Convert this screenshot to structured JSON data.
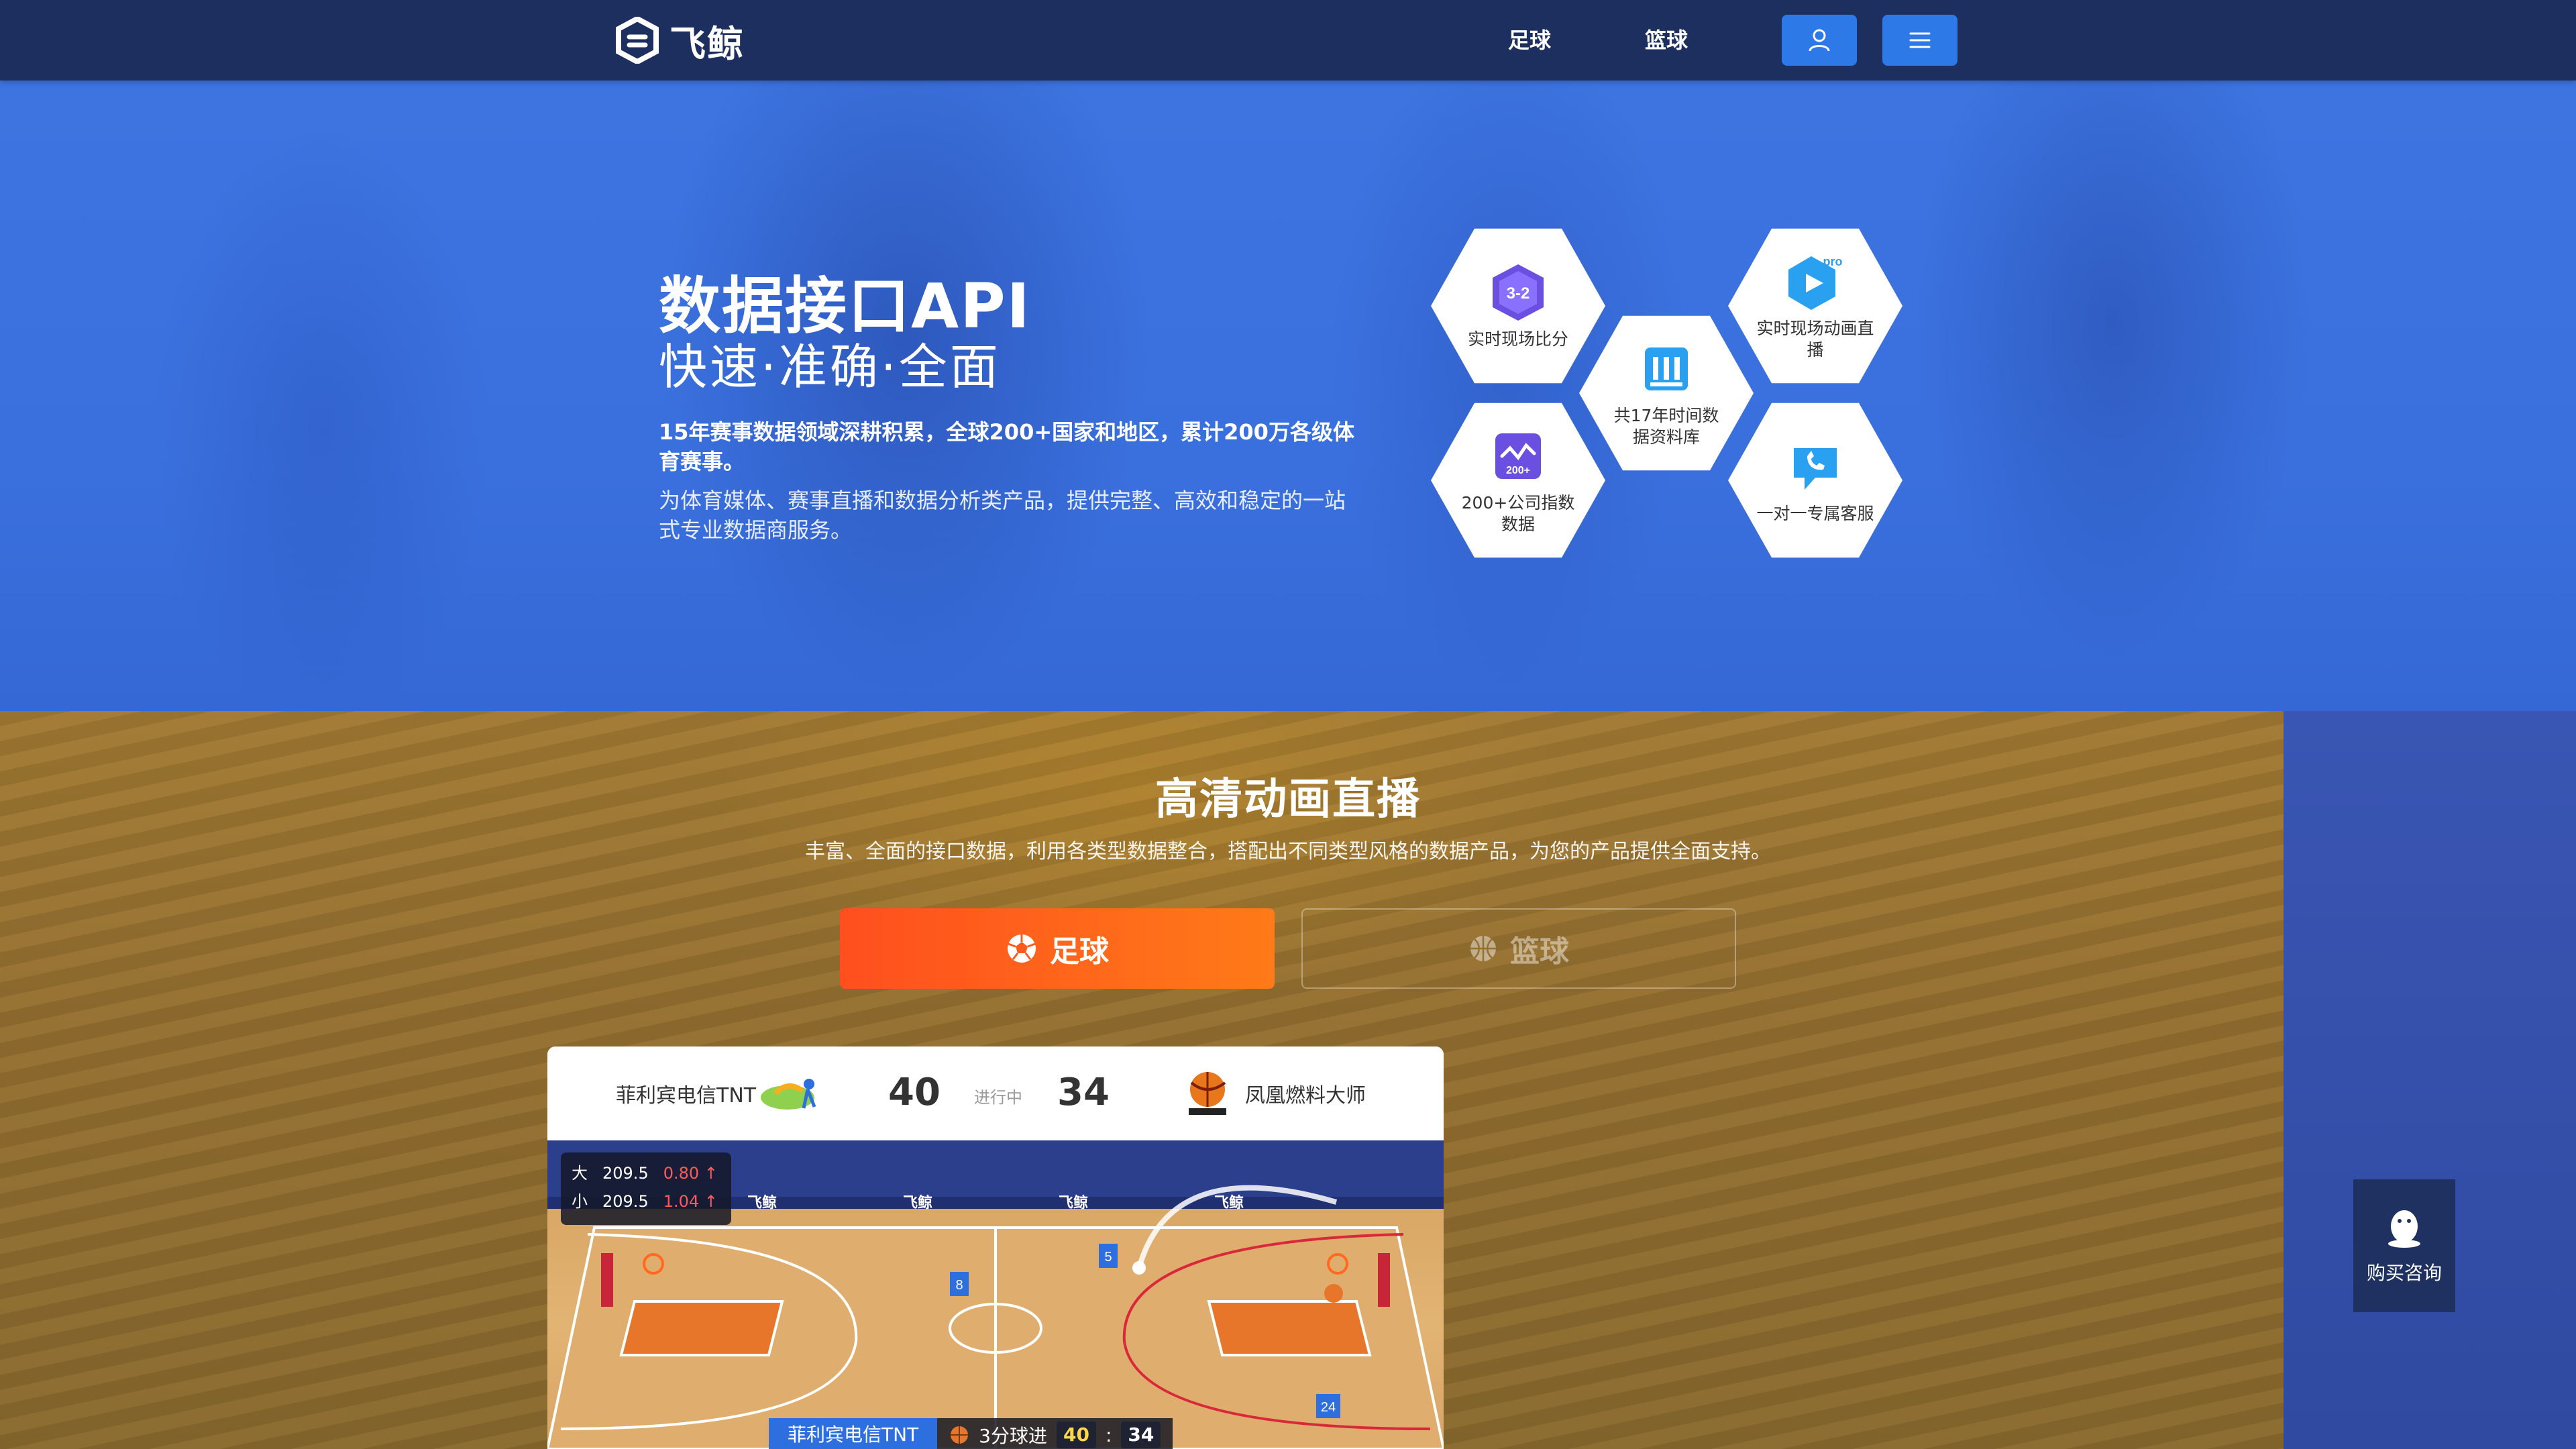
{
  "nav": {
    "logo_text": "飞鲸",
    "links": [
      {
        "label": "足球"
      },
      {
        "label": "篮球"
      }
    ],
    "user_icon": "user-icon",
    "menu_icon": "hamburger-menu-icon"
  },
  "hero": {
    "title": "数据接口API",
    "subtitle": "快速·准确·全面",
    "desc_strong": "15年赛事数据领域深耕积累，全球200+国家和地区，累计200万各级体育赛事。",
    "desc": "为体育媒体、赛事直播和数据分析类产品，提供完整、高效和稳定的一站式专业数据商服务。",
    "features": [
      {
        "label": "实时现场比分",
        "icon": "score-3-2-icon",
        "icon_text": "3-2"
      },
      {
        "label": "共17年时间数据资料库",
        "icon": "database-icon"
      },
      {
        "label": "实时现场动画直播",
        "icon": "pro-play-icon",
        "icon_text": "pro"
      },
      {
        "label": "200+公司指数数据",
        "icon": "index-chart-icon",
        "icon_text": "200+"
      },
      {
        "label": "一对一专属客服",
        "icon": "customer-service-icon"
      }
    ]
  },
  "live": {
    "title": "高清动画直播",
    "subtitle": "丰富、全面的接口数据，利用各类型数据整合，搭配出不同类型风格的数据产品，为您的产品提供全面支持。",
    "tabs": [
      {
        "label": "足球",
        "icon": "soccer-ball-icon",
        "active": true
      },
      {
        "label": "篮球",
        "icon": "basketball-icon",
        "active": false
      }
    ]
  },
  "match": {
    "home_team": "菲利宾电信TNT",
    "away_team": "凤凰燃料大师",
    "home_score": "40",
    "away_score": "34",
    "status": "进行中",
    "odds": [
      {
        "label": "大",
        "line": "209.5",
        "value": "0.80"
      },
      {
        "label": "小",
        "line": "209.5",
        "value": "1.04"
      }
    ],
    "event": {
      "team": "菲利宾电信TNT",
      "text": "3分球进",
      "home_score": "40",
      "separator": ":",
      "away_score": "34"
    },
    "court_banner": "飞鲸",
    "players": [
      "8",
      "5",
      "24"
    ]
  },
  "consult": {
    "label": "购买咨询",
    "icon": "qq-penguin-icon"
  },
  "colors": {
    "nav_bg": "#1d2f5e",
    "hero_bg": "#3d74e0",
    "accent_blue": "#2e79e8",
    "tab_active": "#ff5a1e",
    "live_bg": "#957030"
  }
}
